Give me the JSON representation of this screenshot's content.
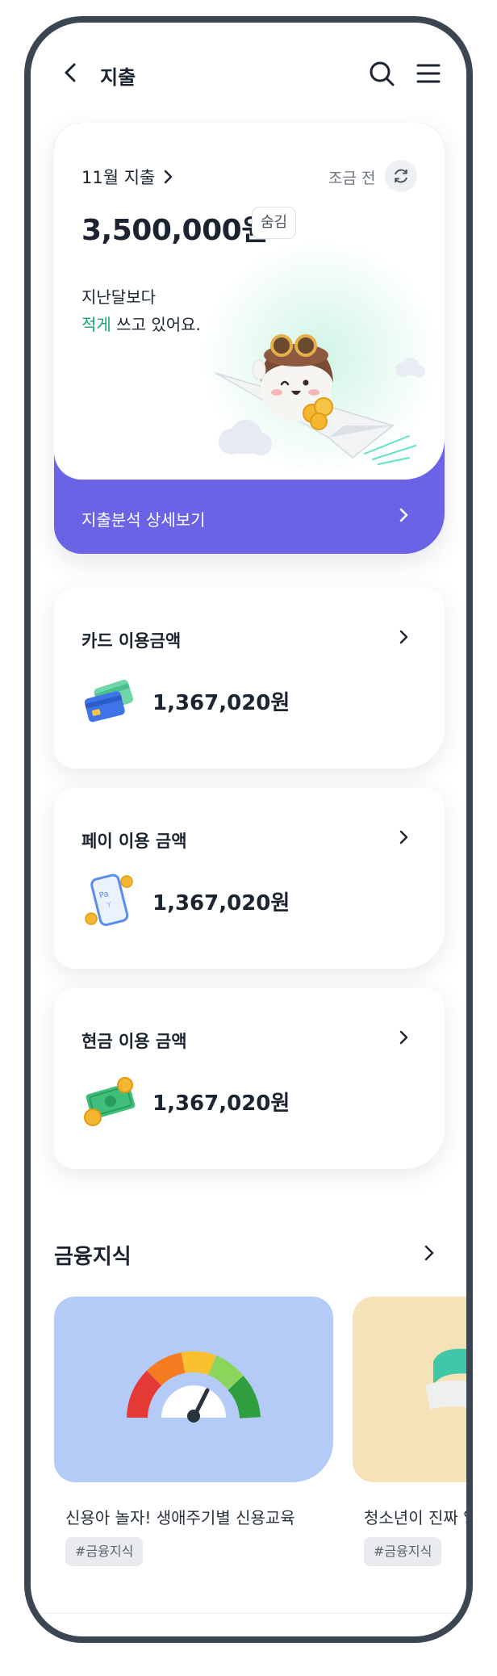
{
  "header": {
    "title": "지출",
    "back_icon": "chevron-left-icon",
    "search_icon": "search-icon",
    "menu_icon": "hamburger-menu-icon"
  },
  "spending": {
    "month_label": "11월 지출",
    "updated_label": "조금 전",
    "amount": "3,500,000원",
    "hide_label": "숨김",
    "compare_prefix": "지난달보다",
    "compare_highlight": "적게",
    "compare_suffix": " 쓰고 있어요.",
    "analysis_label": "지출분석 상세보기",
    "accent_color": "#6b63e6",
    "highlight_color": "#17a37a"
  },
  "usage_cards": [
    {
      "title": "카드 이용금액",
      "amount": "1,367,020원",
      "icon": "credit-card-icon"
    },
    {
      "title": "페이 이용 금액",
      "amount": "1,367,020원",
      "icon": "phone-pay-icon"
    },
    {
      "title": "현금 이용 금액",
      "amount": "1,367,020원",
      "icon": "cash-icon"
    }
  ],
  "knowledge": {
    "section_title": "금융지식",
    "cards": [
      {
        "title": "신용아 놀자! 생애주기별 신용교육",
        "tag": "#금융지식",
        "bg": "#b4cbf8",
        "icon": "credit-gauge-icon"
      },
      {
        "title": "청소년이 진짜 알",
        "tag": "#금융지식",
        "bg": "#f5e2b8",
        "icon": "bell-icon"
      }
    ]
  }
}
